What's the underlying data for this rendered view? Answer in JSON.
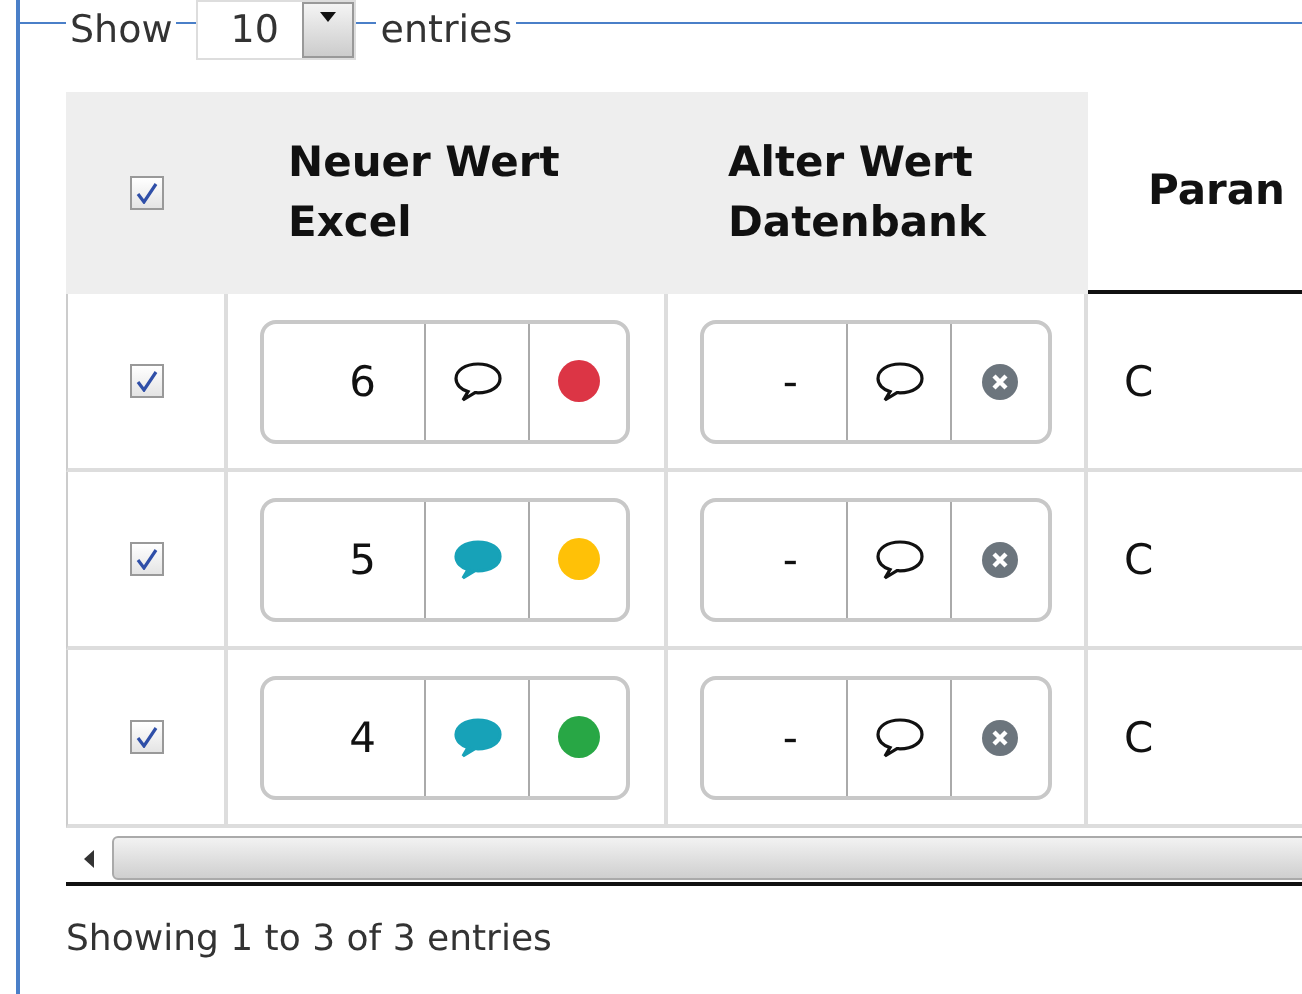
{
  "length_menu": {
    "label_before": "Show",
    "value": "10",
    "label_after": "entries"
  },
  "table": {
    "select_all_checked": true,
    "columns": [
      {
        "label": "Neuer Wert\nExcel",
        "sorted": false
      },
      {
        "label": "Alter Wert\nDatenbank",
        "sorted": false
      },
      {
        "label": "Paran",
        "sorted": true
      }
    ],
    "rows": [
      {
        "checked": true,
        "new_value": "6",
        "new_comment_filled": false,
        "color": "#dc3545",
        "old_value": "-",
        "old_comment_filled": false,
        "param": "C"
      },
      {
        "checked": true,
        "new_value": "5",
        "new_comment_filled": true,
        "color": "#ffc107",
        "old_value": "-",
        "old_comment_filled": false,
        "param": "C"
      },
      {
        "checked": true,
        "new_value": "4",
        "new_comment_filled": true,
        "color": "#28a745",
        "old_value": "-",
        "old_comment_filled": false,
        "param": "C"
      }
    ]
  },
  "info": "Showing 1 to 3 of 3 entries"
}
